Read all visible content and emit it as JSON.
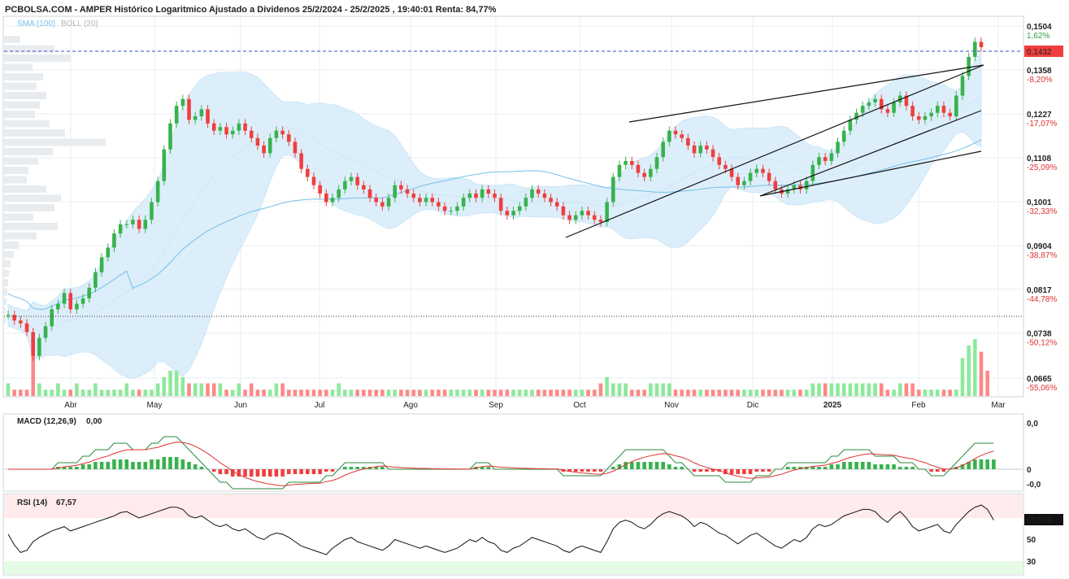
{
  "header": {
    "title": "PCBOLSA.COM - AMPER Histórico Logaritmico Ajustado a Dividenos 25/2/2024 - 25/2/2025 , 19:40:01 Renta: 84,77%",
    "legend_sma": "SMA (100)",
    "legend_boll": "BOLL (20)"
  },
  "colors": {
    "up": "#37b24d",
    "down": "#f03e3e",
    "boll_fill": "#d6ecfa",
    "sma": "#74c0e8",
    "vol_up": "#8ce99a",
    "vol_down": "#ff8787",
    "grid": "#e9ecef",
    "last_price_bg": "#f03e3e"
  },
  "price_axis": {
    "ticks": [
      {
        "value": "0,1504",
        "pct": "1,62%"
      },
      {
        "value": "0,1358",
        "pct": "-8,20%"
      },
      {
        "value": "0,1227",
        "pct": "-17,07%"
      },
      {
        "value": "0,1108",
        "pct": "-25,09%"
      },
      {
        "value": "0,1001",
        "pct": "-32,33%"
      },
      {
        "value": "0,0904",
        "pct": "-38,87%"
      },
      {
        "value": "0,0817",
        "pct": "-44,78%"
      },
      {
        "value": "0,0738",
        "pct": "-50,12%"
      },
      {
        "value": "0,0665",
        "pct": "-55,06%"
      }
    ],
    "last_price": "0,1432"
  },
  "months": [
    "Abr",
    "May",
    "Jun",
    "Jul",
    "Ago",
    "Sep",
    "Oct",
    "Nov",
    "Dic",
    "2025",
    "Feb",
    "Mar"
  ],
  "macd": {
    "label": "MACD (12,26,9)",
    "value": "0,00",
    "axis": [
      "0,0",
      "0",
      "-0,0"
    ]
  },
  "rsi": {
    "label": "RSI (14)",
    "value": "67,57",
    "last": "67,576",
    "axis": [
      "50",
      "30"
    ]
  },
  "chart_data": {
    "type": "candlestick",
    "scale": "log",
    "ylim": [
      0.0665,
      0.1504
    ],
    "series": [
      {
        "name": "SMA (100)"
      },
      {
        "name": "BOLL (20)"
      }
    ],
    "close_approx": [
      0.077,
      0.076,
      0.0755,
      0.074,
      0.07,
      0.073,
      0.075,
      0.078,
      0.079,
      0.081,
      0.078,
      0.079,
      0.08,
      0.082,
      0.085,
      0.088,
      0.09,
      0.093,
      0.095,
      0.095,
      0.096,
      0.094,
      0.096,
      0.1,
      0.105,
      0.113,
      0.12,
      0.125,
      0.127,
      0.121,
      0.122,
      0.124,
      0.12,
      0.118,
      0.119,
      0.117,
      0.118,
      0.12,
      0.118,
      0.116,
      0.114,
      0.112,
      0.116,
      0.118,
      0.117,
      0.115,
      0.112,
      0.108,
      0.106,
      0.104,
      0.102,
      0.1,
      0.101,
      0.103,
      0.105,
      0.106,
      0.104,
      0.103,
      0.101,
      0.1,
      0.099,
      0.101,
      0.104,
      0.103,
      0.102,
      0.101,
      0.1,
      0.101,
      0.1,
      0.099,
      0.098,
      0.098,
      0.099,
      0.101,
      0.102,
      0.101,
      0.103,
      0.102,
      0.101,
      0.098,
      0.097,
      0.098,
      0.099,
      0.101,
      0.103,
      0.102,
      0.101,
      0.1,
      0.099,
      0.097,
      0.096,
      0.097,
      0.098,
      0.097,
      0.096,
      0.0955,
      0.1,
      0.106,
      0.109,
      0.11,
      0.109,
      0.107,
      0.106,
      0.108,
      0.111,
      0.115,
      0.118,
      0.117,
      0.116,
      0.114,
      0.112,
      0.114,
      0.113,
      0.111,
      0.109,
      0.108,
      0.106,
      0.104,
      0.105,
      0.107,
      0.108,
      0.107,
      0.105,
      0.103,
      0.102,
      0.103,
      0.104,
      0.103,
      0.105,
      0.109,
      0.111,
      0.11,
      0.112,
      0.115,
      0.118,
      0.121,
      0.123,
      0.125,
      0.126,
      0.127,
      0.124,
      0.123,
      0.126,
      0.128,
      0.125,
      0.122,
      0.121,
      0.122,
      0.123,
      0.125,
      0.123,
      0.122,
      0.128,
      0.134,
      0.14,
      0.145,
      0.1432
    ],
    "volume_approx": [
      2,
      1,
      1,
      1,
      9,
      2,
      1,
      1,
      2,
      1,
      1,
      2,
      1,
      1,
      2,
      1,
      1,
      1,
      1,
      2,
      1,
      1,
      1,
      1,
      2,
      3,
      4,
      4,
      3,
      2,
      2,
      2,
      2,
      2,
      2,
      1,
      1,
      2,
      1,
      2,
      1,
      1,
      1,
      2,
      2,
      1,
      1,
      1,
      1,
      1,
      1,
      1,
      1,
      2,
      1,
      1,
      1,
      1,
      1,
      1,
      1,
      1,
      1,
      1,
      1,
      1,
      1,
      1,
      1,
      1,
      1,
      1,
      1,
      1,
      1,
      1,
      1,
      1,
      1,
      1,
      1,
      1,
      1,
      1,
      1,
      1,
      1,
      1,
      1,
      1,
      1,
      1,
      1,
      1,
      1,
      2,
      3,
      2,
      2,
      2,
      1,
      1,
      1,
      2,
      2,
      2,
      2,
      1,
      1,
      1,
      1,
      1,
      1,
      1,
      1,
      1,
      1,
      1,
      1,
      1,
      1,
      1,
      1,
      1,
      1,
      1,
      1,
      1,
      1,
      2,
      2,
      2,
      2,
      2,
      2,
      2,
      2,
      2,
      2,
      2,
      2,
      1,
      1,
      2,
      2,
      2,
      1,
      1,
      1,
      1,
      1,
      1,
      1,
      6,
      8,
      9,
      7,
      4
    ],
    "macd_hist_approx": [
      0,
      0,
      0,
      0,
      0,
      0,
      0,
      0,
      1,
      1,
      1,
      1,
      2,
      2,
      3,
      3,
      3,
      4,
      4,
      4,
      3,
      3,
      3,
      4,
      4,
      5,
      5,
      5,
      4,
      3,
      2,
      1,
      0,
      -1,
      -2,
      -2,
      -3,
      -3,
      -3,
      -3,
      -3,
      -3,
      -3,
      -3,
      -3,
      -2,
      -2,
      -2,
      -2,
      -2,
      -2,
      -1,
      -1,
      0,
      1,
      1,
      1,
      1,
      1,
      1,
      1,
      0,
      0,
      0,
      0,
      0,
      0,
      0,
      0,
      0,
      0,
      0,
      0,
      0,
      0,
      1,
      1,
      1,
      0,
      0,
      0,
      0,
      0,
      0,
      0,
      0,
      0,
      0,
      0,
      -1,
      -1,
      -1,
      -1,
      -1,
      -1,
      -1,
      0,
      1,
      2,
      3,
      3,
      3,
      3,
      3,
      3,
      3,
      2,
      1,
      1,
      0,
      -1,
      -1,
      -1,
      -1,
      -1,
      -2,
      -2,
      -2,
      -2,
      -2,
      -1,
      -1,
      -1,
      0,
      0,
      1,
      1,
      1,
      1,
      1,
      1,
      1,
      2,
      2,
      3,
      3,
      3,
      3,
      3,
      2,
      2,
      2,
      2,
      1,
      1,
      1,
      0,
      0,
      -1,
      -1,
      -1,
      0,
      1,
      2,
      3,
      4,
      4,
      4,
      4
    ],
    "rsi_approx": [
      55,
      45,
      38,
      40,
      48,
      52,
      55,
      58,
      60,
      62,
      58,
      60,
      62,
      64,
      66,
      68,
      70,
      72,
      75,
      76,
      73,
      70,
      72,
      74,
      76,
      78,
      80,
      80,
      78,
      72,
      70,
      72,
      68,
      64,
      62,
      64,
      60,
      58,
      60,
      56,
      52,
      50,
      54,
      56,
      55,
      52,
      48,
      44,
      42,
      40,
      38,
      36,
      42,
      46,
      50,
      52,
      48,
      46,
      44,
      42,
      40,
      44,
      50,
      48,
      46,
      44,
      42,
      44,
      42,
      40,
      38,
      40,
      42,
      46,
      50,
      48,
      52,
      48,
      46,
      40,
      38,
      42,
      44,
      48,
      52,
      50,
      48,
      46,
      44,
      40,
      38,
      42,
      44,
      42,
      40,
      38,
      48,
      60,
      66,
      68,
      66,
      62,
      60,
      64,
      70,
      74,
      76,
      74,
      72,
      68,
      62,
      66,
      64,
      60,
      56,
      54,
      50,
      46,
      50,
      54,
      56,
      52,
      48,
      44,
      42,
      46,
      50,
      48,
      52,
      60,
      64,
      62,
      64,
      68,
      72,
      74,
      76,
      78,
      78,
      76,
      70,
      66,
      72,
      76,
      70,
      62,
      58,
      60,
      62,
      64,
      58,
      56,
      64,
      70,
      76,
      80,
      82,
      78,
      68
    ]
  }
}
